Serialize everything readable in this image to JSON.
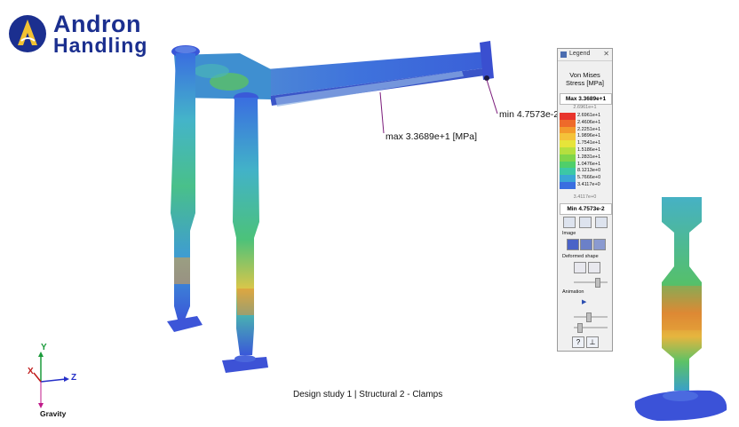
{
  "logo": {
    "line1": "Andron",
    "line2": "Handling",
    "brand_color": "#1b2f8f"
  },
  "annotations": {
    "max_label": "max  3.3689e+1  [MPa]",
    "min_label": "min  4.7573e-2"
  },
  "study_title": "Design study 1 | Structural  2 - Clamps",
  "axes": {
    "y": "Y",
    "x": "X",
    "z": "Z",
    "gravity": "Gravity"
  },
  "legend": {
    "window_title": "Legend",
    "quantity_line1": "Von Mises",
    "quantity_line2": "Stress [MPa]",
    "max_label": "Max  3.3689e+1",
    "top_value": "2.6961e+1",
    "scale": [
      {
        "value": "2.6961e+1",
        "color": "#e8342c"
      },
      {
        "value": "2.4606e+1",
        "color": "#ee6a2a"
      },
      {
        "value": "2.2251e+1",
        "color": "#f39a2c"
      },
      {
        "value": "1.9896e+1",
        "color": "#f4c23a"
      },
      {
        "value": "1.7541e+1",
        "color": "#e6e43a"
      },
      {
        "value": "1.5186e+1",
        "color": "#b5df3f"
      },
      {
        "value": "1.2831e+1",
        "color": "#7fd54a"
      },
      {
        "value": "1.0476e+1",
        "color": "#4fcf6a"
      },
      {
        "value": "8.1213e+0",
        "color": "#3cc8a6"
      },
      {
        "value": "5.7666e+0",
        "color": "#3aa6d6"
      },
      {
        "value": "3.4117e+0",
        "color": "#3a6ee0"
      }
    ],
    "bottom_value": "3.4117e+0",
    "min_label": "Min  4.7573e-2",
    "section_image": "Image",
    "section_deformed": "Deformed shape",
    "section_animation": "Animation",
    "play_glyph": "▶",
    "help_glyph": "?",
    "pin_glyph": "⊥",
    "close_glyph": "✕"
  }
}
